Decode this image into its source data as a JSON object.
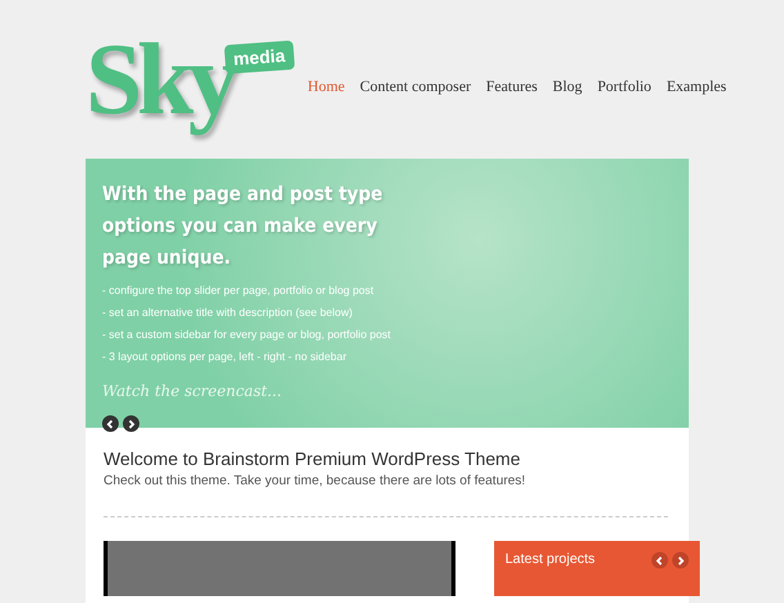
{
  "logo": {
    "word": "Sky",
    "badge": "media"
  },
  "nav": [
    {
      "label": "Home",
      "selected": true
    },
    {
      "label": "Content composer",
      "selected": false
    },
    {
      "label": "Features",
      "selected": false
    },
    {
      "label": "Blog",
      "selected": false
    },
    {
      "label": "Portfolio",
      "selected": false
    },
    {
      "label": "Examples",
      "selected": false
    }
  ],
  "slider": {
    "heading": "With the page and post type options you can make every page unique.",
    "bullets": [
      "- configure the top slider per page, portfolio or blog post",
      "- set an alternative title with description (see below)",
      "- set a custom sidebar for every page or blog, portfolio post",
      "- 3 layout options per page, left - right - no sidebar"
    ],
    "link": "Watch the screencast..."
  },
  "welcome": {
    "title": "Welcome to Brainstorm Premium WordPress Theme",
    "subtitle": "Check out this theme. Take your time, because there are lots of features!"
  },
  "latest_projects": {
    "title": "Latest projects"
  }
}
